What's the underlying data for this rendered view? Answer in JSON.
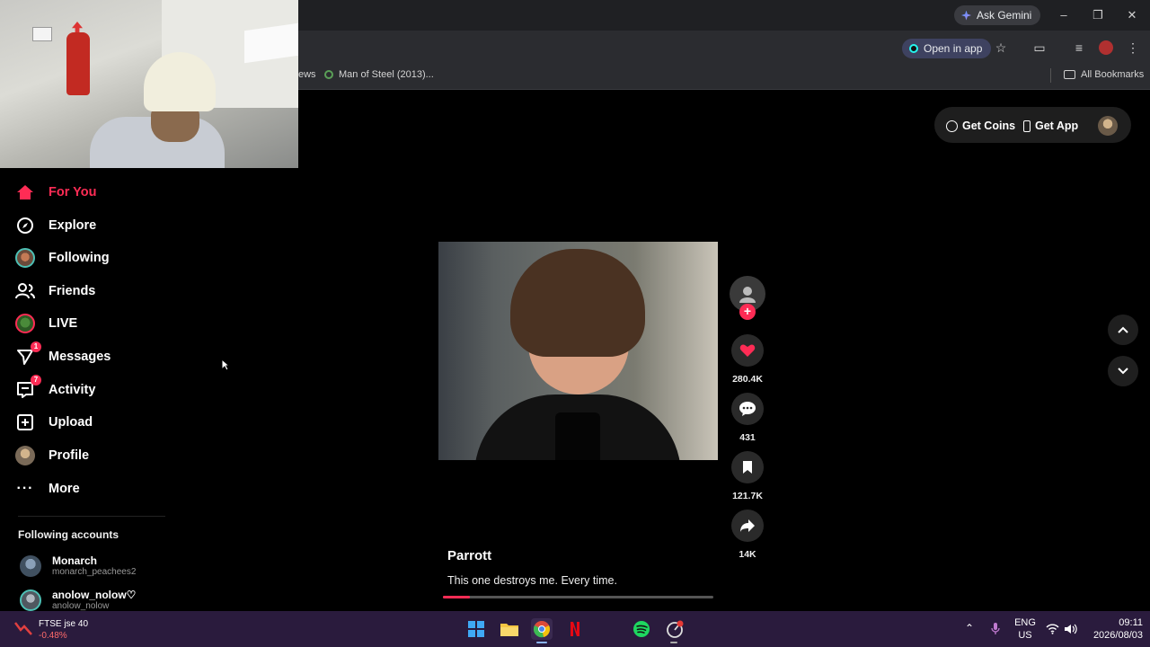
{
  "browser": {
    "ask_gemini": "Ask Gemini",
    "open_in_app": "Open in app",
    "bookmark_truncated": "ews",
    "bookmark_1": "Man of Steel (2013)...",
    "all_bookmarks": "All Bookmarks"
  },
  "sidebar": {
    "items": [
      {
        "label": "For You",
        "active": true
      },
      {
        "label": "Explore"
      },
      {
        "label": "Following"
      },
      {
        "label": "Friends"
      },
      {
        "label": "LIVE"
      },
      {
        "label": "Messages",
        "badge": "1"
      },
      {
        "label": "Activity",
        "badge": "7"
      },
      {
        "label": "Upload"
      },
      {
        "label": "Profile"
      },
      {
        "label": "More"
      }
    ],
    "following_heading": "Following accounts",
    "accounts": [
      {
        "name": "Monarch",
        "handle": "monarch_peachees2"
      },
      {
        "name": "anolow_nolow♡",
        "handle": "anolow_nolow"
      }
    ]
  },
  "header": {
    "get_coins": "Get Coins",
    "get_app": "Get App"
  },
  "video": {
    "author": "Parrott",
    "caption": "This one destroys me. Every time.",
    "progress": 0.1,
    "likes": "280.4K",
    "comments": "431",
    "saves": "121.7K",
    "shares": "14K"
  },
  "taskbar": {
    "stock_name": "FTSE jse 40",
    "stock_change": "-0.48%",
    "lang_1": "ENG",
    "lang_2": "US",
    "time": "09:11",
    "date": "2026/08/03"
  },
  "colors": {
    "accent": "#fe2c55",
    "background": "#000000",
    "taskbar": "#2a1b3d"
  }
}
